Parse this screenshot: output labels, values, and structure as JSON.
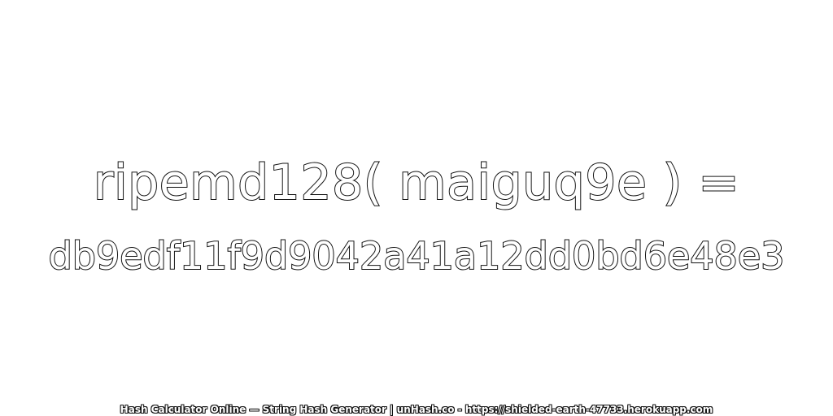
{
  "expression": "ripemd128( maiguq9e ) =",
  "hash": "db9edf11f9d9042a41a12dd0bd6e48e3",
  "footer": "Hash Calculator Online — String Hash Generator | unHash.co - https://shielded-earth-47733.herokuapp.com",
  "colors": {
    "background": "#ffffff",
    "text_fill": "#ffffff",
    "text_outline": "#111111"
  }
}
